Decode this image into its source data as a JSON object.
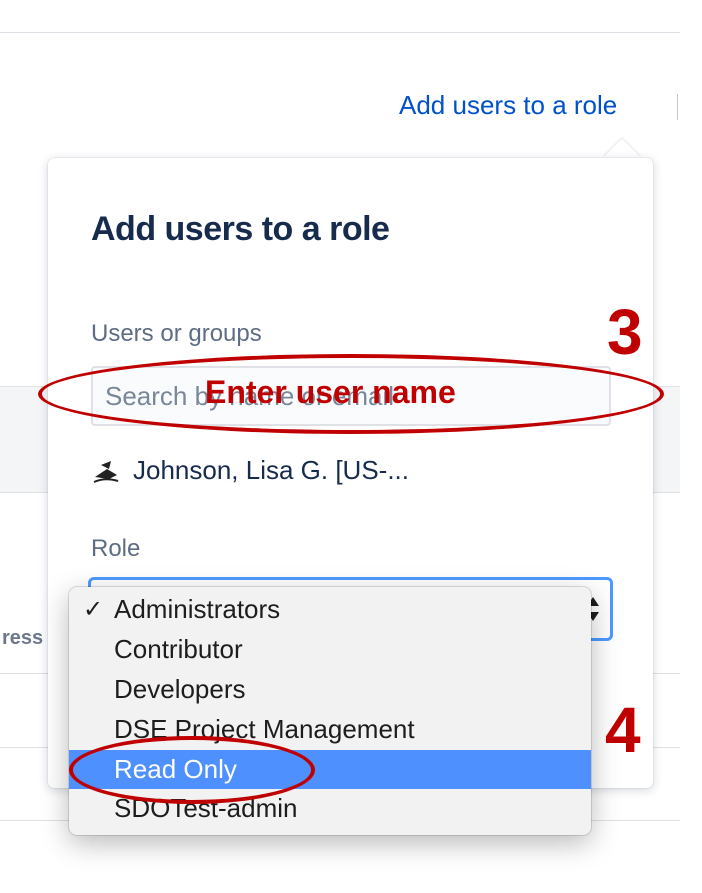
{
  "page": {
    "link_label": "Add users to a role",
    "left_cut_text": "ress"
  },
  "dialog": {
    "title": "Add users to a role",
    "users_label": "Users or groups",
    "search_placeholder": "Search by name or email",
    "selected_user": "Johnson, Lisa G. [US-...",
    "role_label": "Role",
    "role_options": [
      {
        "label": "Administrators",
        "checked": true,
        "highlighted": false
      },
      {
        "label": "Contributor",
        "checked": false,
        "highlighted": false
      },
      {
        "label": "Developers",
        "checked": false,
        "highlighted": false
      },
      {
        "label": "DSE Project Management",
        "checked": false,
        "highlighted": false
      },
      {
        "label": "Read Only",
        "checked": false,
        "highlighted": true
      },
      {
        "label": "SDOTest-admin",
        "checked": false,
        "highlighted": false
      }
    ],
    "checkmark": "✓"
  },
  "annotations": {
    "step3": "3",
    "step3_note": "Enter user name",
    "step4": "4",
    "color": "#c00000"
  },
  "colors": {
    "link": "#0052cc",
    "menu_highlight": "#4d90fe",
    "focus_border": "#4c9aff"
  }
}
